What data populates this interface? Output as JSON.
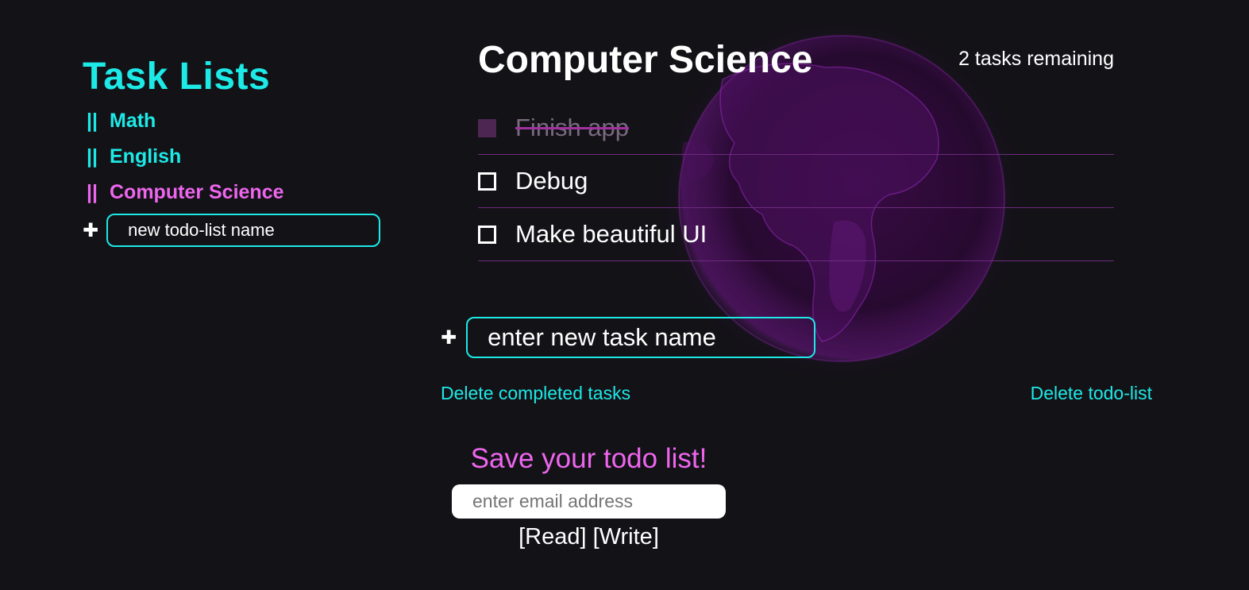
{
  "sidebar": {
    "title": "Task Lists",
    "items": [
      {
        "handle": "||",
        "label": "Math",
        "active": false
      },
      {
        "handle": "||",
        "label": "English",
        "active": false
      },
      {
        "handle": "||",
        "label": "Computer Science",
        "active": true
      }
    ],
    "add_icon": "plus-icon",
    "new_list_placeholder": "new todo-list name"
  },
  "main": {
    "title": "Computer Science",
    "remaining": "2 tasks remaining",
    "tasks": [
      {
        "label": "Finish app",
        "done": true
      },
      {
        "label": "Debug",
        "done": false
      },
      {
        "label": "Make beautiful UI",
        "done": false
      }
    ],
    "add_icon": "plus-icon",
    "new_task_placeholder": "enter new task name",
    "delete_completed_label": "Delete completed tasks",
    "delete_list_label": "Delete todo-list"
  },
  "save": {
    "title": "Save your todo list!",
    "email_placeholder": "enter email address",
    "read_label": "[Read]",
    "write_label": "[Write]"
  },
  "colors": {
    "background": "#131217",
    "accent_cyan": "#1de9e6",
    "accent_magenta": "#ee66ee",
    "divider": "#6d2a7e"
  },
  "decor": {
    "background_image": "globe-icon"
  }
}
